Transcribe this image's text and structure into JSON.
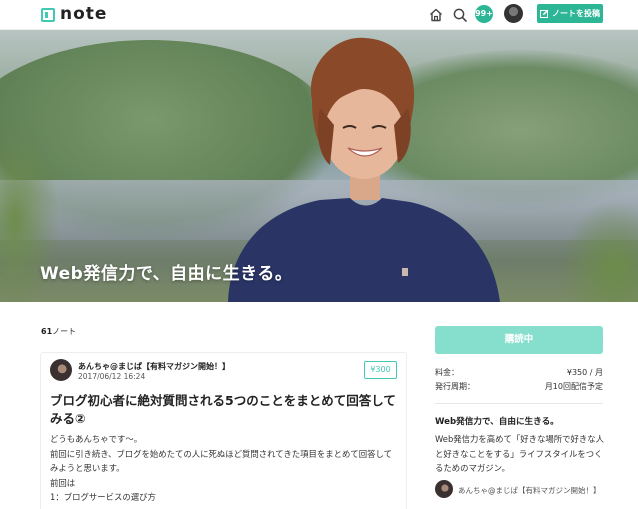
{
  "header": {
    "logo_text": "note",
    "notifications_count": "99+",
    "post_button_label": "ノートを投稿"
  },
  "hero": {
    "title": "Web発信力で、自由に生きる。"
  },
  "main": {
    "note_count": "61",
    "note_count_unit": "ノート",
    "note": {
      "author": "あんちゃ@まじぱ【有料マガジン開始！】",
      "date": "2017/06/12 16:24",
      "price": "¥300",
      "title": "ブログ初心者に絶対質問される5つのことをまとめて回答してみる②",
      "body": [
        "どうもあんちゃです〜。",
        "前回に引き続き、ブログを始めたての人に死ぬほど質問されてきた項目をまとめて回答して",
        "みようと思います。",
        "前回は",
        "1：ブログサービスの選び方"
      ]
    }
  },
  "sidebar": {
    "buy_button_label": "購読中",
    "fee_label": "料金：",
    "fee_value": "¥350 / 月",
    "cycle_label": "発行周期：",
    "cycle_value": "月10回配信予定",
    "magazine_title": "Web発信力で、自由に生きる。",
    "magazine_desc": "Web発信力を高めて「好きな場所で好きな人と好きなことをする」ライフスタイルをつくるためのマガジン。",
    "author": "あんちゃ@まじぱ【有料マガジン開始！】"
  },
  "colors": {
    "accent": "#2cb696",
    "accent_light": "#86dfcd",
    "logo": "#41c9b4"
  },
  "icons": {
    "home": "home-icon",
    "search": "search-icon",
    "pen": "pen-icon"
  }
}
